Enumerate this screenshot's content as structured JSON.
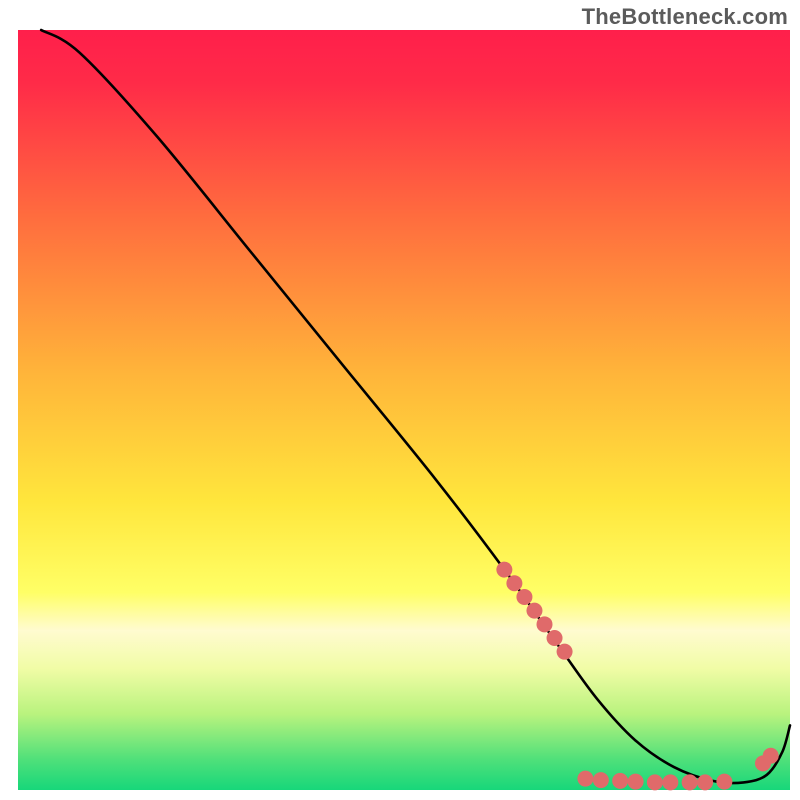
{
  "watermark": "TheBottleneck.com",
  "chart_data": {
    "type": "line",
    "title": "",
    "xlabel": "",
    "ylabel": "",
    "xlim": [
      0,
      100
    ],
    "ylim": [
      0,
      100
    ],
    "grid": false,
    "legend": false,
    "background_gradient": {
      "top_color": "#ff1f4b",
      "mid_color": "#ffe93c",
      "bottom_color": "#17d77a",
      "pale_band_color": "#fffde0",
      "pale_band_y_range": [
        73,
        79
      ]
    },
    "series": [
      {
        "name": "bottleneck-curve",
        "color": "#000000",
        "x": [
          3,
          8,
          18,
          30,
          42,
          54,
          63,
          70,
          75,
          80,
          85,
          90,
          94,
          97,
          99,
          100
        ],
        "y": [
          100,
          97,
          86,
          71,
          56,
          41,
          29,
          19,
          12,
          6.5,
          3,
          1.2,
          1.0,
          2.0,
          5.0,
          8.5
        ],
        "description": "smooth monotone descent from top-left, flattening to a shallow minimum around x≈90–94, then a short rise toward the right edge"
      }
    ],
    "markers": {
      "name": "highlight-dots",
      "color": "#e06a6a",
      "radius": 8,
      "points": [
        {
          "x": 63,
          "y": 29
        },
        {
          "x": 64.3,
          "y": 27.2
        },
        {
          "x": 65.6,
          "y": 25.4
        },
        {
          "x": 66.9,
          "y": 23.6
        },
        {
          "x": 68.2,
          "y": 21.8
        },
        {
          "x": 69.5,
          "y": 20.0
        },
        {
          "x": 70.8,
          "y": 18.2
        },
        {
          "x": 73.5,
          "y": 1.5
        },
        {
          "x": 75.5,
          "y": 1.3
        },
        {
          "x": 78.0,
          "y": 1.2
        },
        {
          "x": 80.0,
          "y": 1.1
        },
        {
          "x": 82.5,
          "y": 1.0
        },
        {
          "x": 84.5,
          "y": 1.0
        },
        {
          "x": 87.0,
          "y": 1.0
        },
        {
          "x": 89.0,
          "y": 1.0
        },
        {
          "x": 91.5,
          "y": 1.1
        },
        {
          "x": 96.5,
          "y": 3.5
        },
        {
          "x": 97.5,
          "y": 4.5
        }
      ]
    }
  }
}
